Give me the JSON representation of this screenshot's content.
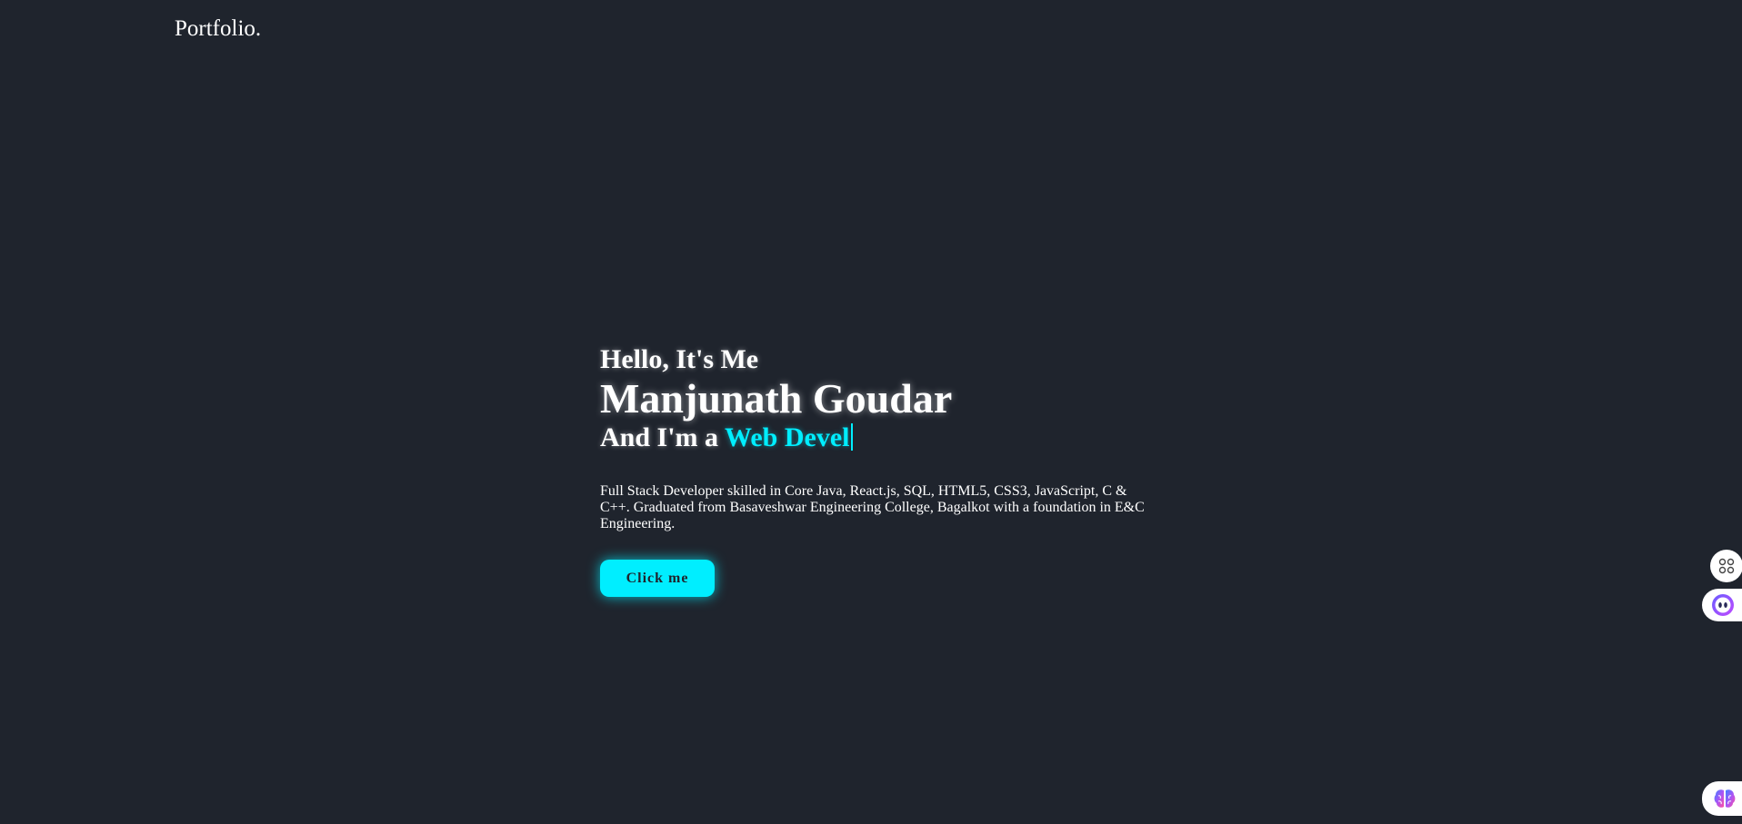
{
  "header": {
    "logo": "Portfolio."
  },
  "hero": {
    "greeting": "Hello, It's Me",
    "name": "Manjunath Goudar",
    "role_prefix": "And I'm a ",
    "role_text": "Web Devel",
    "description": "Full Stack Developer skilled in Core Java, React.js, SQL, HTML5, CSS3, JavaScript, C & C++. Graduated from Basaveshwar Engineering College, Bagalkot with a foundation in E&C Engineering.",
    "cta_label": "Click me"
  },
  "floating_widgets": {
    "apps_icon": "apps-grid-icon",
    "bot_icon": "assistant-bot-icon",
    "brain_icon": "brain-icon"
  },
  "colors": {
    "background": "#1f242d",
    "accent": "#00eeff",
    "text": "#ffffff"
  }
}
